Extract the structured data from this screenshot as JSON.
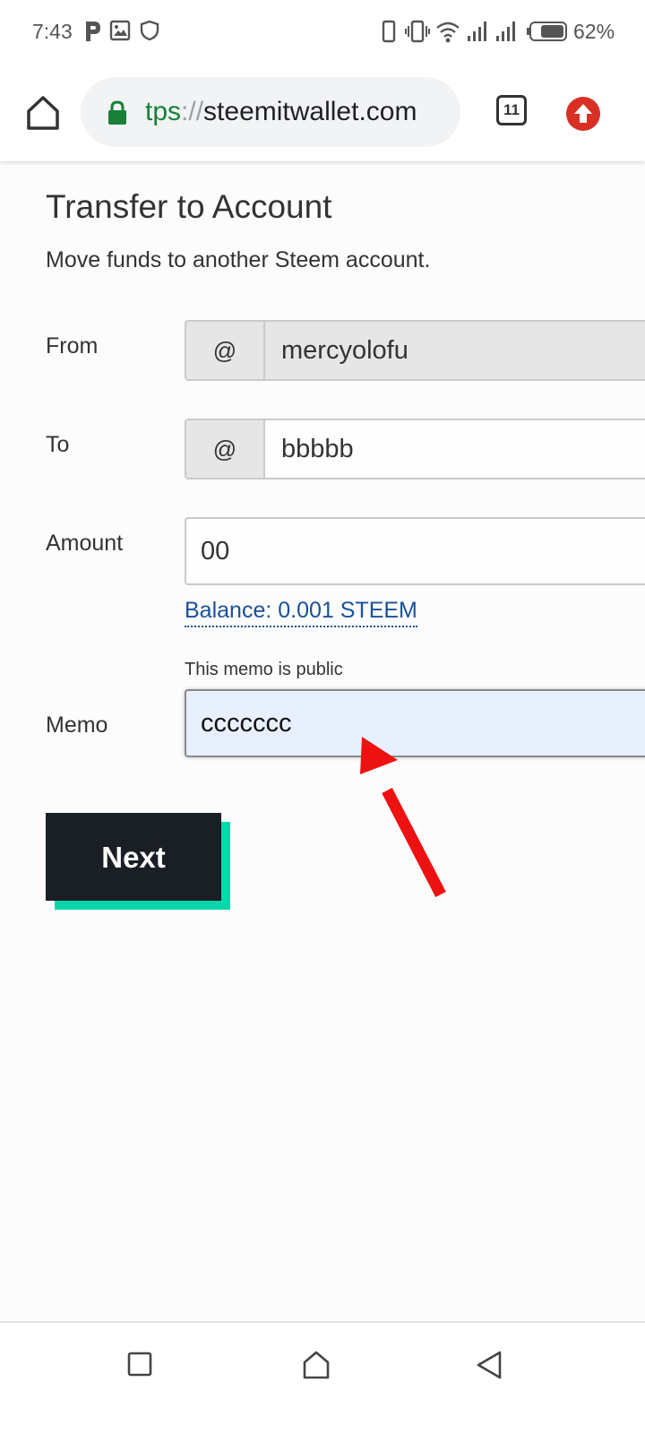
{
  "status_bar": {
    "time": "7:43",
    "battery_percent": "62%",
    "icons": [
      "p-app-icon",
      "image-icon",
      "shield-icon",
      "phone-icon",
      "vibrate-icon",
      "wifi-icon",
      "signal-icon",
      "signal-icon",
      "battery-icon"
    ]
  },
  "browser": {
    "url_scheme": "tps",
    "url_separator": "://",
    "url_host": "steemitwallet.com",
    "tab_count": "11",
    "lock_color": "#188038"
  },
  "page": {
    "title": "Transfer to Account",
    "subtitle": "Move funds to another Steem account."
  },
  "form": {
    "from_label": "From",
    "to_label": "To",
    "amount_label": "Amount",
    "memo_label": "Memo",
    "at_symbol": "@",
    "from_value": "mercyolofu",
    "to_value": "bbbbb",
    "amount_value": "00",
    "balance_text": "Balance: 0.001 STEEM",
    "memo_hint": "This memo is public",
    "memo_value": "ccccccc"
  },
  "actions": {
    "next_label": "Next"
  },
  "colors": {
    "accent": "#06d6a9",
    "button_bg": "#1a1f26",
    "link": "#1a5099",
    "annotation": "#ee1111"
  },
  "nav": {
    "icons": [
      "recents-icon",
      "home-icon",
      "back-icon"
    ]
  }
}
